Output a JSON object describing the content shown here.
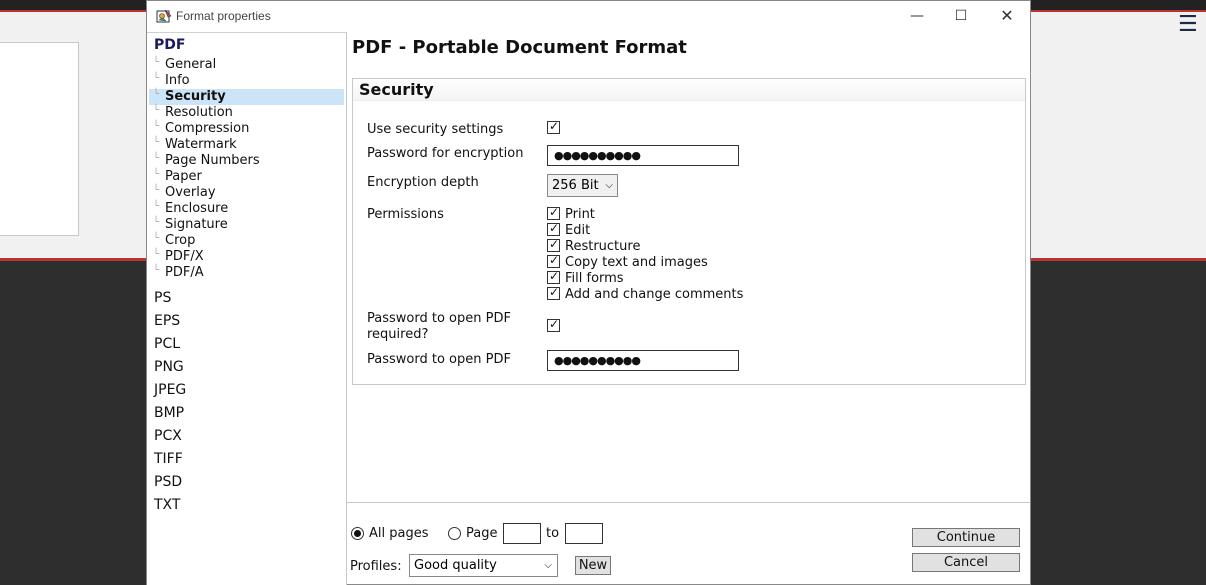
{
  "window": {
    "title": "Format properties",
    "minimize_glyph": "—",
    "maximize_glyph": "☐",
    "close_glyph": "✕"
  },
  "background_app": {
    "menu_icon": "hamburger-menu-icon",
    "menu_glyph": "☰"
  },
  "nav": {
    "pdf_group": "PDF",
    "pdf_items": [
      {
        "label": "General"
      },
      {
        "label": "Info"
      },
      {
        "label": "Security"
      },
      {
        "label": "Resolution"
      },
      {
        "label": "Compression"
      },
      {
        "label": "Watermark"
      },
      {
        "label": "Page Numbers"
      },
      {
        "label": "Paper"
      },
      {
        "label": "Overlay"
      },
      {
        "label": "Enclosure"
      },
      {
        "label": "Signature"
      },
      {
        "label": "Crop"
      },
      {
        "label": "PDF/X"
      },
      {
        "label": "PDF/A"
      }
    ],
    "selected": "Security",
    "other_formats": [
      "PS",
      "EPS",
      "PCL",
      "PNG",
      "JPEG",
      "BMP",
      "PCX",
      "TIFF",
      "PSD",
      "TXT"
    ]
  },
  "main": {
    "title": "PDF - Portable Document Format",
    "section_title": "Security",
    "use_security_label": "Use security settings",
    "use_security_checked": true,
    "password_encryption_label": "Password for encryption",
    "password_encryption_value": "●●●●●●●●●●",
    "encryption_depth_label": "Encryption depth",
    "encryption_depth_value": "256 Bit",
    "permissions_label": "Permissions",
    "permissions": [
      {
        "label": "Print",
        "checked": true
      },
      {
        "label": "Edit",
        "checked": true
      },
      {
        "label": "Restructure",
        "checked": true
      },
      {
        "label": "Copy text and images",
        "checked": true
      },
      {
        "label": "Fill forms",
        "checked": true
      },
      {
        "label": "Add and change comments",
        "checked": true
      }
    ],
    "open_required_label_line1": "Password to open PDF",
    "open_required_label_line2": "required?",
    "open_required_checked": true,
    "open_password_label": "Password to open PDF",
    "open_password_value": "●●●●●●●●●●"
  },
  "footer": {
    "all_pages_label": "All pages",
    "all_pages_selected": true,
    "page_label": "Page",
    "page_from": "",
    "to_label": "to",
    "page_to": "",
    "profiles_label": "Profiles:",
    "profile_value": "Good quality",
    "new_button": "New",
    "continue_button": "Continue",
    "cancel_button": "Cancel"
  },
  "glyphs": {
    "check": "✓",
    "chevron_down": "⌵",
    "tree_branch": "└"
  }
}
